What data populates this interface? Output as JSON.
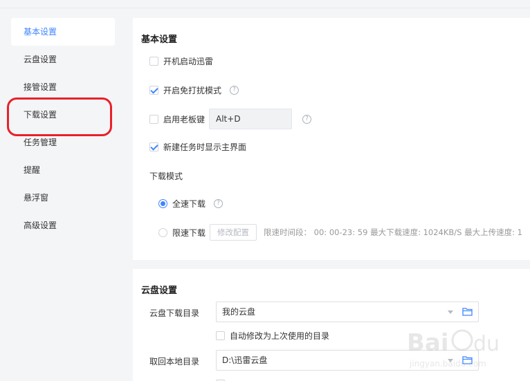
{
  "sidebar": {
    "items": [
      {
        "label": "基本设置",
        "active": true
      },
      {
        "label": "云盘设置"
      },
      {
        "label": "接管设置"
      },
      {
        "label": "下载设置"
      },
      {
        "label": "任务管理"
      },
      {
        "label": "提醒"
      },
      {
        "label": "悬浮窗"
      },
      {
        "label": "高级设置"
      }
    ]
  },
  "basic": {
    "title": "基本设置",
    "startup_label": "开机启动迅雷",
    "startup_checked": false,
    "nodisturb_label": "开启免打扰模式",
    "nodisturb_checked": true,
    "bosskey_label": "启用老板键",
    "bosskey_checked": false,
    "bosskey_value": "Alt+D",
    "showmain_label": "新建任务时显示主界面",
    "showmain_checked": true,
    "download_mode_label": "下载模式",
    "fullspeed_label": "全速下载",
    "limit_label": "限速下载",
    "modify_btn": "修改配置",
    "limit_info": "限速时间段： 00: 00-23: 59   最大下载速度: 1024KB/S    最大上传速度: 1"
  },
  "cloud": {
    "title": "云盘设置",
    "dl_dir_label": "云盘下载目录",
    "dl_dir_value": "我的云盘",
    "auto_change_label": "自动修改为上次使用的目录",
    "local_dir_label": "取回本地目录",
    "local_dir_value": "D:\\迅雷云盘"
  },
  "colors": {
    "accent": "#3f85ff",
    "highlight_ring": "#e8202a"
  }
}
